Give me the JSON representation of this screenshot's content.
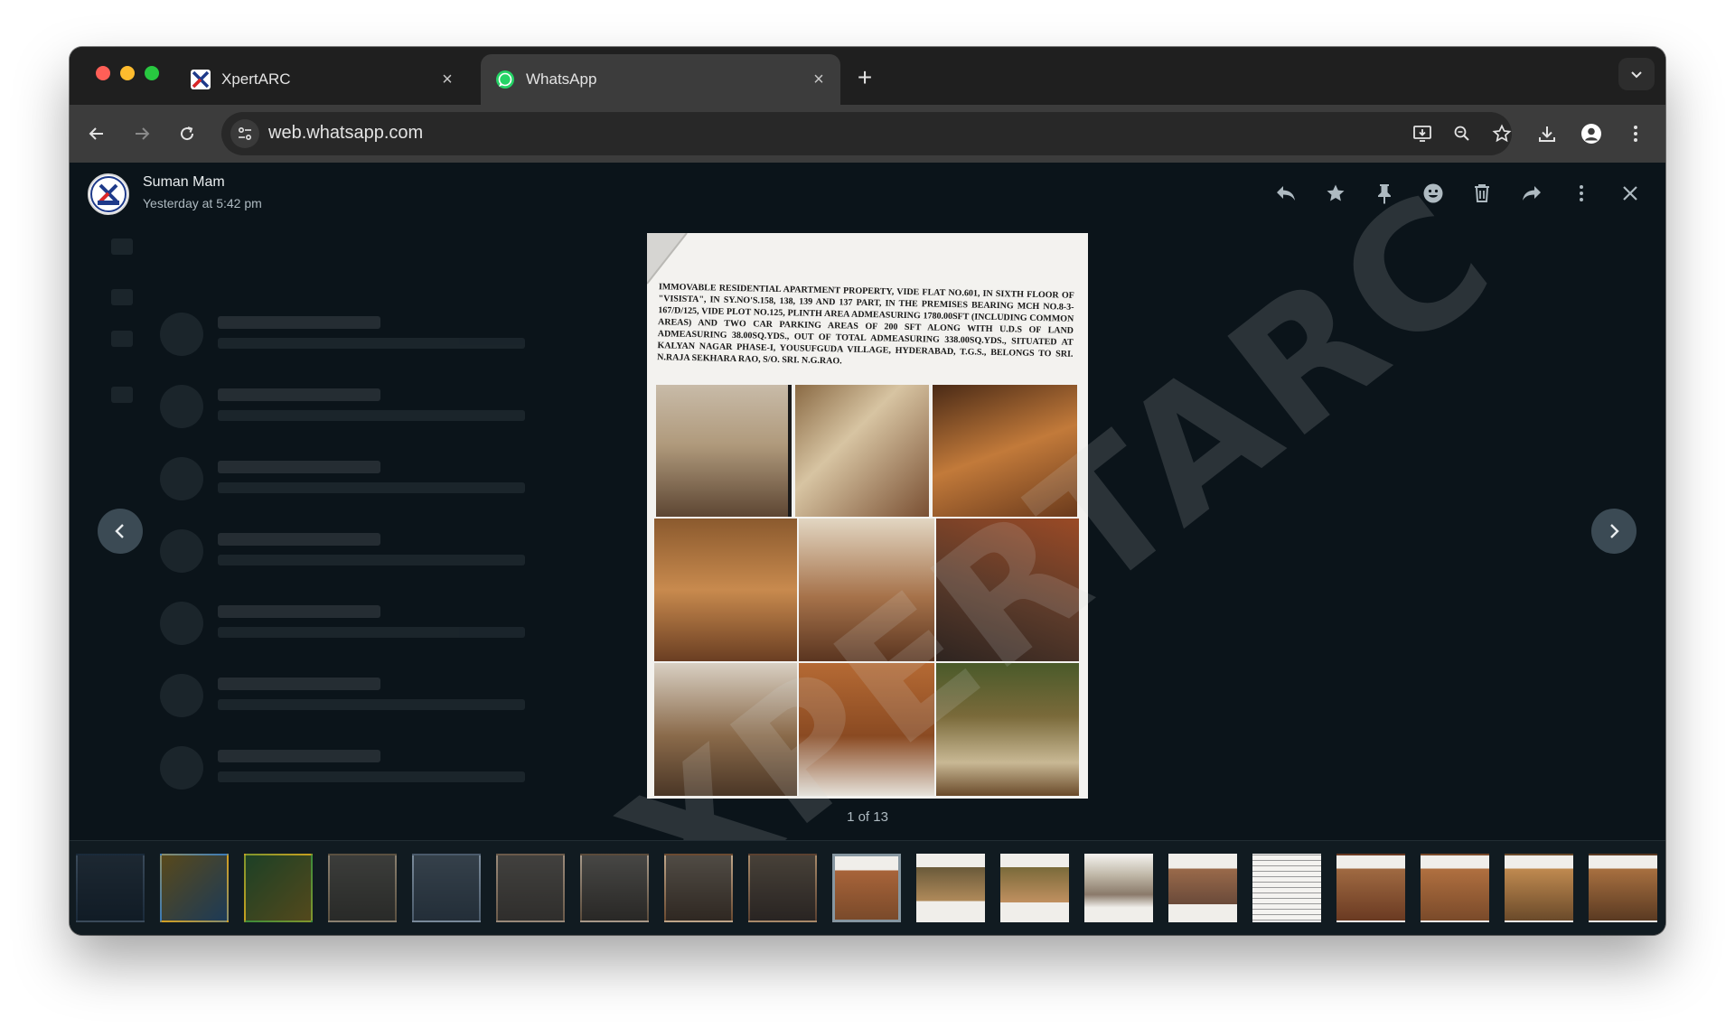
{
  "browser": {
    "tabs": [
      {
        "title": "XpertARC",
        "close": "×"
      },
      {
        "title": "WhatsApp",
        "close": "×"
      }
    ],
    "new_tab": "+",
    "url": "web.whatsapp.com"
  },
  "viewer": {
    "sender_name": "Suman Mam",
    "sender_time": "Yesterday at 5:42 pm",
    "counter": "1 of 13",
    "watermark": "XPERTARC",
    "actions": [
      "reply",
      "star",
      "pin",
      "react",
      "delete",
      "forward",
      "menu",
      "close"
    ]
  },
  "document": {
    "text": "IMMOVABLE RESIDENTIAL APARTMENT PROPERTY, VIDE FLAT NO.601, IN SIXTH FLOOR OF \"VISISTA\", IN SY.NO'S.158, 138, 139 AND 137 PART, IN THE PREMISES BEARING MCH NO.8-3-167/D/125, VIDE PLOT NO.125, PLINTH AREA ADMEASURING 1780.00SFT (INCLUDING COMMON AREAS) AND TWO CAR PARKING AREAS OF 200 SFT ALONG WITH U.D.S OF LAND ADMEASURING 38.00SQ.YDS., OUT OF TOTAL ADMEASURING 338.00SQ.YDS., SITUATED AT KALYAN NAGAR PHASE-I, YOUSUFGUDA VILLAGE, HYDERABAD, T.G.S., BELONGS TO SRI. N.RAJA SEKHARA RAO, S/O. SRI. N.G.RAO."
  },
  "thumbnails": {
    "count": 19,
    "active_index": 9
  },
  "colors": {
    "chrome_tab_bar": "#1f1f1f",
    "chrome_toolbar": "#3c3c3c",
    "viewer_bg": "#0b141a",
    "whatsapp_green": "#25d366",
    "nav_button": "#3b4a54"
  }
}
